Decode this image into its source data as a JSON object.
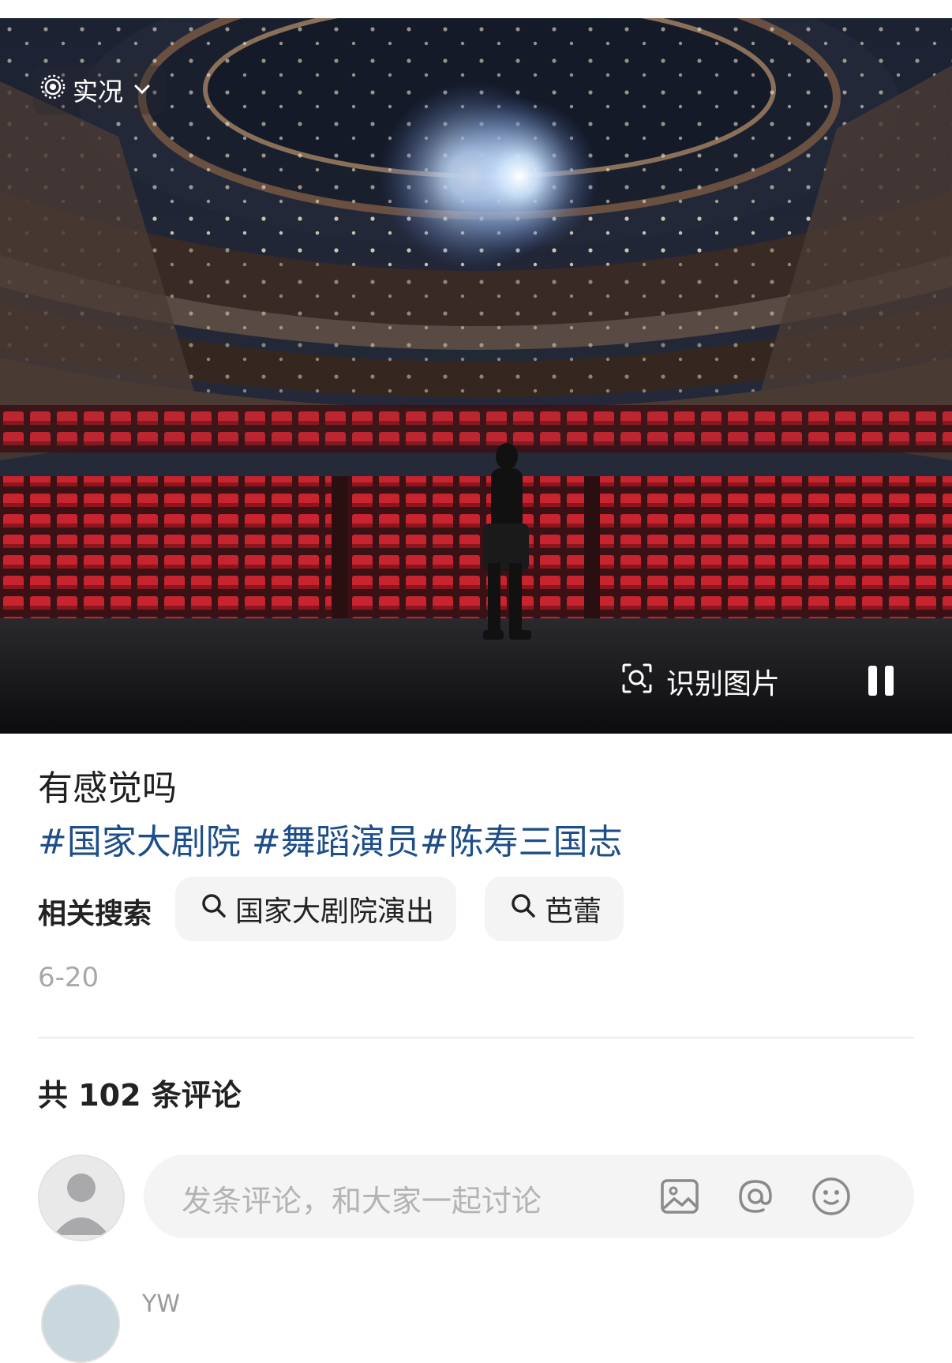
{
  "photo": {
    "live_label": "实况",
    "identify_label": "识别图片"
  },
  "post": {
    "title": "有感觉吗",
    "tags": [
      "#国家大剧院",
      " #舞蹈演员",
      "#陈寿三国志"
    ],
    "related_label": "相关搜索",
    "related_searches": [
      "国家大剧院演出",
      "芭蕾"
    ],
    "date": "6-20"
  },
  "comments": {
    "count_label": "共 102 条评论",
    "input_placeholder": "发条评论，和大家一起讨论",
    "next_user": "YW"
  },
  "colors": {
    "tag_blue": "#1d4e89",
    "seat_red": "#c8242f"
  },
  "icons": [
    "live-photo-icon",
    "chevron-down-icon",
    "scan-image-icon",
    "pause-icon",
    "search-icon",
    "image-icon",
    "at-icon",
    "emoji-icon"
  ]
}
